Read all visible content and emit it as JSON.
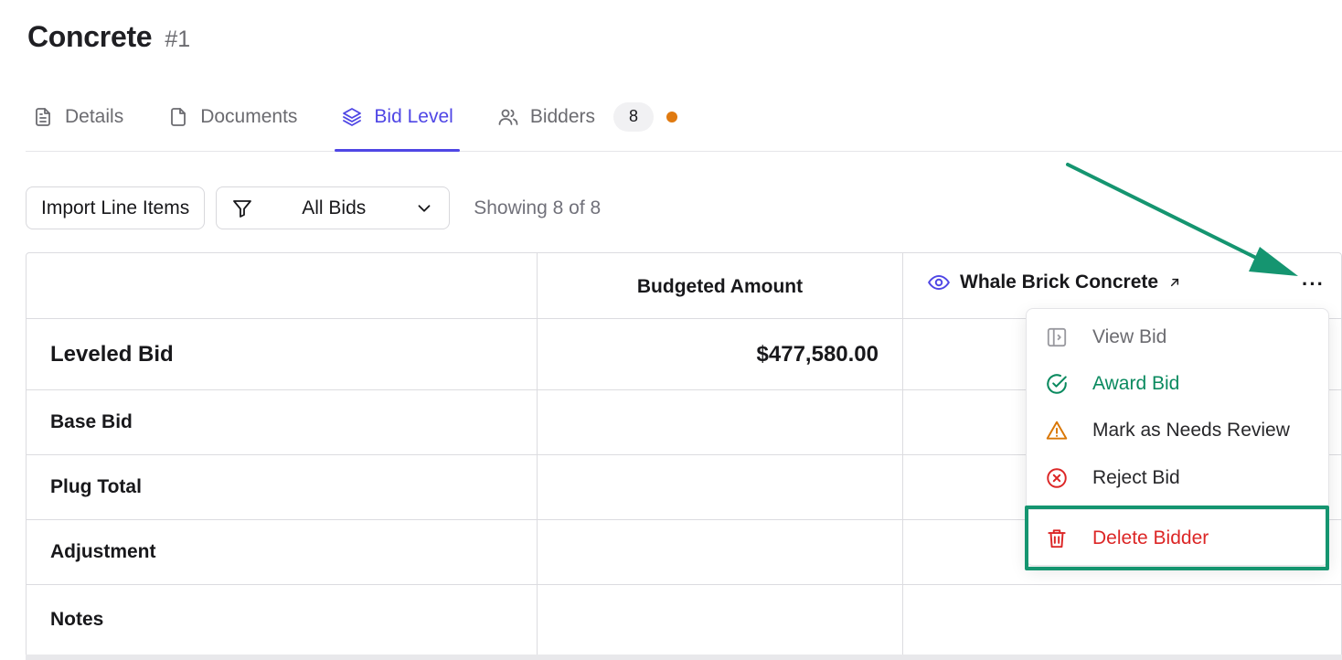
{
  "page": {
    "title": "Concrete",
    "number": "#1"
  },
  "tabs": [
    {
      "label": "Details",
      "icon": "document-lines-icon"
    },
    {
      "label": "Documents",
      "icon": "file-icon"
    },
    {
      "label": "Bid Level",
      "icon": "layers-icon",
      "active": true
    },
    {
      "label": "Bidders",
      "icon": "users-icon",
      "count": "8"
    }
  ],
  "toolbar": {
    "import_label": "Import Line Items",
    "filter_label": "All Bids",
    "showing": "Showing 8 of 8"
  },
  "table": {
    "col_budget": "Budgeted Amount",
    "bidder_name": "Whale Brick Concrete",
    "more_label": "···",
    "rows": [
      {
        "label": "Leveled Bid",
        "budget": "$477,580.00"
      },
      {
        "label": "Base Bid",
        "budget": ""
      },
      {
        "label": "Plug Total",
        "budget": ""
      },
      {
        "label": "Adjustment",
        "budget": ""
      },
      {
        "label": "Notes",
        "budget": ""
      }
    ]
  },
  "menu": {
    "view": "View Bid",
    "award": "Award Bid",
    "review": "Mark as Needs Review",
    "reject": "Reject Bid",
    "delete": "Delete Bidder"
  },
  "colors": {
    "accent": "#4f46e5",
    "award": "#0a8a5f",
    "warning": "#d97706",
    "danger": "#dc2626",
    "annotation": "#159570",
    "notify_dot": "#e07a10"
  }
}
